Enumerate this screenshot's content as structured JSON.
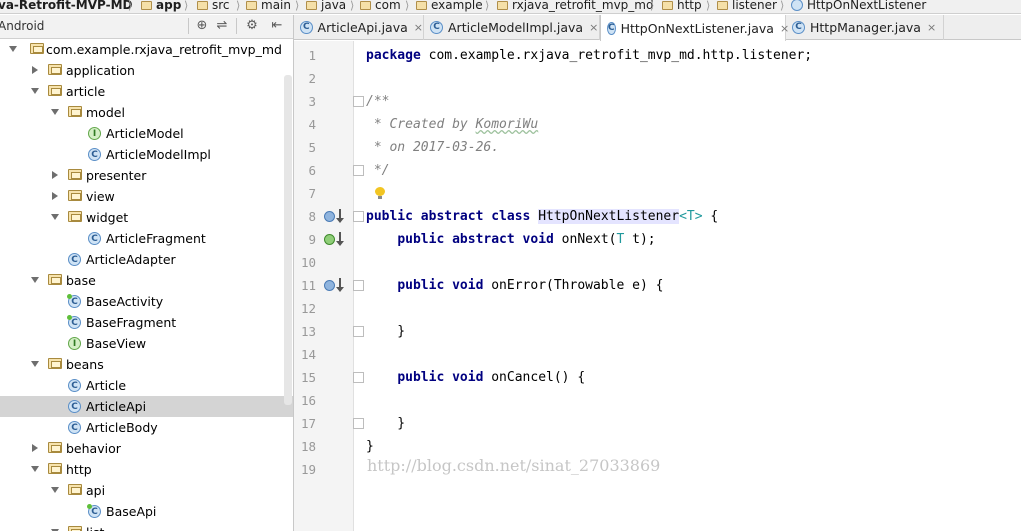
{
  "breadcrumb": {
    "project": "va-Retrofit-MVP-MD",
    "module": "app",
    "items": [
      "src",
      "main",
      "java",
      "com",
      "example",
      "rxjava_retrofit_mvp_md",
      "http",
      "listener"
    ],
    "current": "HttpOnNextListener"
  },
  "project_panel": {
    "view_name": "Android",
    "tools": {
      "locate": "⊕",
      "collapse": "⇌",
      "settings": "⚙",
      "hide": "⇤"
    }
  },
  "tree": [
    {
      "label": "com.example.rxjava_retrofit_mvp_md",
      "kind": "folder",
      "arrow": "expanded"
    },
    {
      "label": "application",
      "kind": "folder",
      "arrow": "collapsed"
    },
    {
      "label": "article",
      "kind": "folder",
      "arrow": "expanded"
    },
    {
      "label": "model",
      "kind": "folder",
      "arrow": "expanded"
    },
    {
      "label": "ArticleModel",
      "kind": "interface",
      "icon_letter": "I"
    },
    {
      "label": "ArticleModelImpl",
      "kind": "class",
      "icon_letter": "C"
    },
    {
      "label": "presenter",
      "kind": "folder",
      "arrow": "collapsed"
    },
    {
      "label": "view",
      "kind": "folder",
      "arrow": "collapsed"
    },
    {
      "label": "widget",
      "kind": "folder",
      "arrow": "expanded"
    },
    {
      "label": "ArticleFragment",
      "kind": "class",
      "icon_letter": "C"
    },
    {
      "label": "ArticleAdapter",
      "kind": "class",
      "icon_letter": "C"
    },
    {
      "label": "base",
      "kind": "folder",
      "arrow": "expanded"
    },
    {
      "label": "BaseActivity",
      "kind": "class",
      "icon_letter": "C",
      "badge": true
    },
    {
      "label": "BaseFragment",
      "kind": "class",
      "icon_letter": "C",
      "badge": true
    },
    {
      "label": "BaseView",
      "kind": "interface",
      "icon_letter": "I"
    },
    {
      "label": "beans",
      "kind": "folder",
      "arrow": "expanded"
    },
    {
      "label": "Article",
      "kind": "class",
      "icon_letter": "C"
    },
    {
      "label": "ArticleApi",
      "kind": "class",
      "icon_letter": "C",
      "selected": true
    },
    {
      "label": "ArticleBody",
      "kind": "class",
      "icon_letter": "C"
    },
    {
      "label": "behavior",
      "kind": "folder",
      "arrow": "collapsed"
    },
    {
      "label": "http",
      "kind": "folder",
      "arrow": "expanded"
    },
    {
      "label": "api",
      "kind": "folder",
      "arrow": "expanded"
    },
    {
      "label": "BaseApi",
      "kind": "class",
      "icon_letter": "C",
      "badge": true
    },
    {
      "label": "list",
      "kind": "folder",
      "arrow": "expanded"
    }
  ],
  "tabs": [
    {
      "label": "ArticleApi.java",
      "icon_letter": "C",
      "active": false
    },
    {
      "label": "ArticleModelImpl.java",
      "icon_letter": "C",
      "active": false
    },
    {
      "label": "HttpOnNextListener.java",
      "icon_letter": "C",
      "active": true
    },
    {
      "label": "HttpManager.java",
      "icon_letter": "C",
      "active": false
    }
  ],
  "close_glyph": "×",
  "editor": {
    "line_numbers": [
      "1",
      "2",
      "3",
      "4",
      "5",
      "6",
      "7",
      "8",
      "9",
      "10",
      "11",
      "12",
      "13",
      "14",
      "15",
      "16",
      "17",
      "18",
      "19"
    ],
    "lines": [
      {
        "n": 1,
        "tokens": [
          {
            "t": "package",
            "c": "kw"
          },
          {
            "t": " com.example.rxjava_retrofit_mvp_md.http.listener;",
            "c": ""
          }
        ]
      },
      {
        "n": 2,
        "tokens": []
      },
      {
        "n": 3,
        "tokens": [
          {
            "t": "/**",
            "c": "cm"
          }
        ]
      },
      {
        "n": 4,
        "tokens": [
          {
            "t": " * Created by ",
            "c": "cm"
          },
          {
            "t": "KomoriWu",
            "c": "cm squiggle"
          }
        ]
      },
      {
        "n": 5,
        "tokens": [
          {
            "t": " * on 2017-03-26.",
            "c": "cm"
          }
        ]
      },
      {
        "n": 6,
        "tokens": [
          {
            "t": " */",
            "c": "cm"
          }
        ]
      },
      {
        "n": 7,
        "tokens": []
      },
      {
        "n": 8,
        "tokens": [
          {
            "t": "public abstract class",
            "c": "kw"
          },
          {
            "t": " ",
            "c": ""
          },
          {
            "t": "HttpOnNextListener",
            "c": "cls-hl"
          },
          {
            "t": "<T>",
            "c": "tp"
          },
          {
            "t": " {",
            "c": ""
          }
        ]
      },
      {
        "n": 9,
        "tokens": [
          {
            "t": "    ",
            "c": ""
          },
          {
            "t": "public abstract void",
            "c": "kw"
          },
          {
            "t": " onNext(",
            "c": ""
          },
          {
            "t": "T",
            "c": "tp"
          },
          {
            "t": " t);",
            "c": ""
          }
        ]
      },
      {
        "n": 10,
        "tokens": []
      },
      {
        "n": 11,
        "tokens": [
          {
            "t": "    ",
            "c": ""
          },
          {
            "t": "public void",
            "c": "kw"
          },
          {
            "t": " onError(Throwable e) {",
            "c": ""
          }
        ]
      },
      {
        "n": 12,
        "tokens": []
      },
      {
        "n": 13,
        "tokens": [
          {
            "t": "    }",
            "c": ""
          }
        ]
      },
      {
        "n": 14,
        "tokens": []
      },
      {
        "n": 15,
        "tokens": [
          {
            "t": "    ",
            "c": ""
          },
          {
            "t": "public void",
            "c": "kw"
          },
          {
            "t": " onCancel() {",
            "c": ""
          }
        ]
      },
      {
        "n": 16,
        "tokens": []
      },
      {
        "n": 17,
        "tokens": [
          {
            "t": "    }",
            "c": ""
          }
        ]
      },
      {
        "n": 18,
        "tokens": [
          {
            "t": "}",
            "c": ""
          }
        ]
      },
      {
        "n": 19,
        "tokens": []
      }
    ],
    "gutter_marks": [
      {
        "line": 8,
        "kind": "o"
      },
      {
        "line": 9,
        "kind": "i"
      },
      {
        "line": 11,
        "kind": "o"
      }
    ],
    "fold_lines": [
      3,
      6,
      8,
      11,
      13,
      15,
      17
    ],
    "bulb_line": 7
  },
  "watermark": "http://blog.csdn.net/sinat_27033869"
}
